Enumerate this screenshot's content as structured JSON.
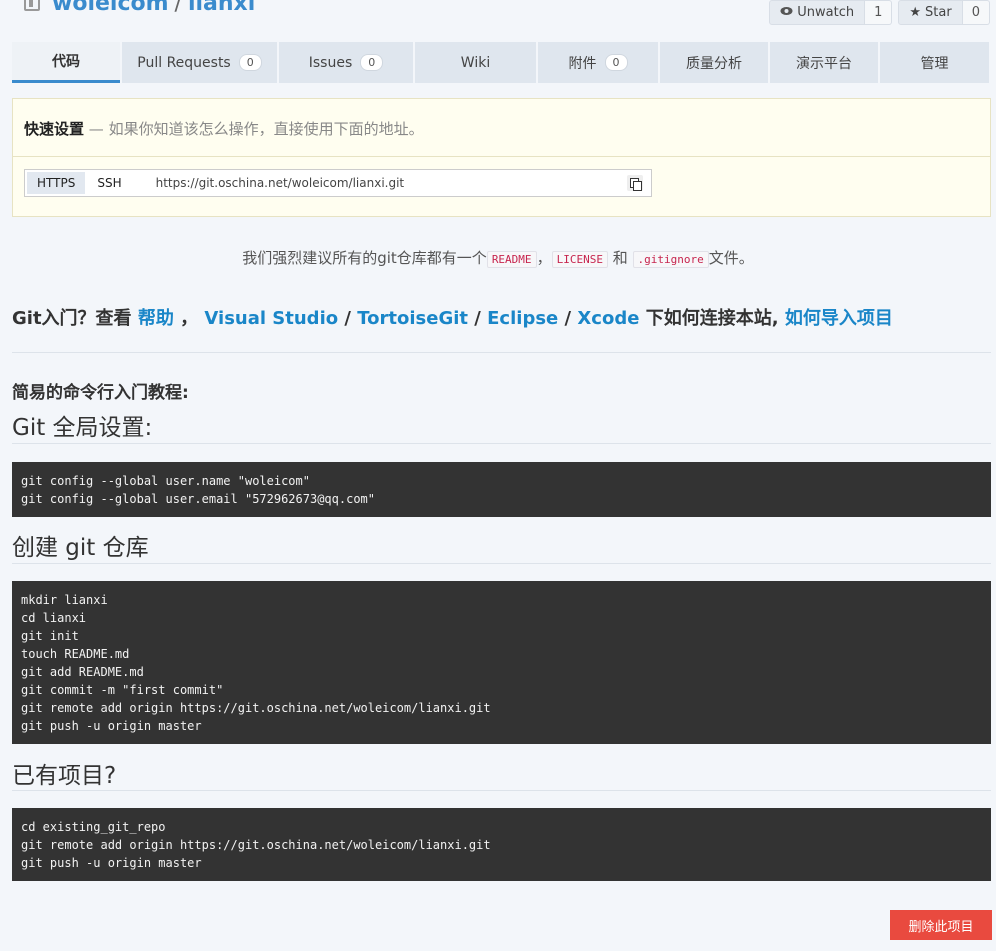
{
  "header": {
    "owner": "woleicom",
    "separator": "/",
    "repo": "lianxi",
    "watch": {
      "label": "Unwatch",
      "icon": "eye-icon",
      "count": "1"
    },
    "star": {
      "label": "Star",
      "icon": "star-icon",
      "count": "0"
    }
  },
  "tabs": [
    {
      "label": "代码",
      "badge": ""
    },
    {
      "label": "Pull Requests",
      "badge": "0"
    },
    {
      "label": "Issues",
      "badge": "0"
    },
    {
      "label": "Wiki",
      "badge": ""
    },
    {
      "label": "附件",
      "badge": "0"
    },
    {
      "label": "质量分析",
      "badge": ""
    },
    {
      "label": "演示平台",
      "badge": ""
    },
    {
      "label": "管理",
      "badge": ""
    }
  ],
  "quick": {
    "title": "快速设置",
    "description": "— 如果你知道该怎么操作，直接使用下面的地址。",
    "protocols": [
      "HTTPS",
      "SSH"
    ],
    "url": "https://git.oschina.net/woleicom/lianxi.git"
  },
  "recommend": {
    "prefix": "我们强烈建议所有的git仓库都有一个",
    "readme": "README",
    "comma": "，",
    "license": "LICENSE",
    "and": "和",
    "gitignore": ".gitignore",
    "suffix": "文件。"
  },
  "intro": {
    "prefix": "Git入门？查看",
    "help": "帮助",
    "comma": "，",
    "vs": "Visual Studio",
    "tortoise": "TortoiseGit",
    "eclipse": "Eclipse",
    "xcode": "Xcode",
    "slash": "/",
    "middle": "下如何连接本站,",
    "import": "如何导入项目"
  },
  "tutorial": {
    "title": "简易的命令行入门教程:",
    "sections": [
      {
        "heading": "Git 全局设置:",
        "lines": [
          "git config --global user.name \"woleicom\"",
          "git config --global user.email \"572962673@qq.com\""
        ]
      },
      {
        "heading": "创建 git 仓库",
        "lines": [
          "mkdir lianxi",
          "cd lianxi",
          "git init",
          "touch README.md",
          "git add README.md",
          "git commit -m \"first commit\"",
          "git remote add origin https://git.oschina.net/woleicom/lianxi.git",
          "git push -u origin master"
        ]
      },
      {
        "heading": "已有项目?",
        "lines": [
          "cd existing_git_repo",
          "git remote add origin https://git.oschina.net/woleicom/lianxi.git",
          "git push -u origin master"
        ]
      }
    ]
  },
  "delete_button": "删除此项目"
}
